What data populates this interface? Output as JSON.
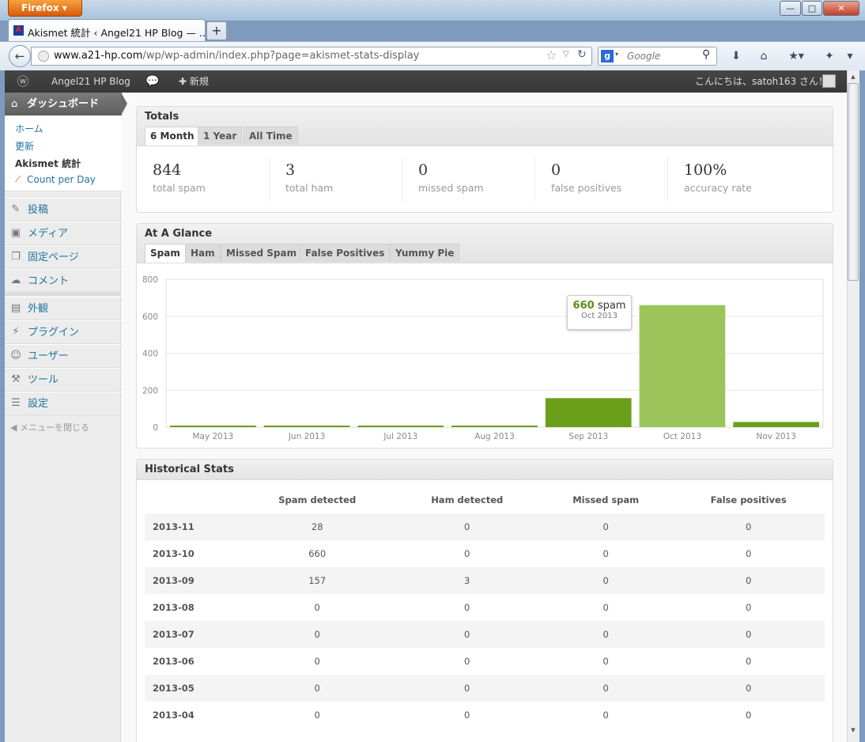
{
  "browser": {
    "menu_button": "Firefox",
    "tab_title": "Akismet 統計 ‹ Angel21 HP Blog — ...",
    "url_host": "www.a21-hp.com",
    "url_path": "/wp/wp-admin/index.php?page=akismet-stats-display",
    "search_placeholder": "Google",
    "new_tab": "+"
  },
  "adminbar": {
    "site_name": "Angel21 HP Blog",
    "new_label": "新規",
    "greeting": "こんにちは、satoh163 さん！"
  },
  "sidebar": {
    "dashboard": "ダッシュボード",
    "submenu": [
      "ホーム",
      "更新",
      "Akismet 統計",
      "Count per Day"
    ],
    "menu": [
      {
        "label": "投稿",
        "icon": "pin-icon"
      },
      {
        "label": "メディア",
        "icon": "media-icon"
      },
      {
        "label": "固定ページ",
        "icon": "pages-icon"
      },
      {
        "label": "コメント",
        "icon": "comment-icon"
      },
      {
        "label": "外観",
        "icon": "appearance-icon"
      },
      {
        "label": "プラグイン",
        "icon": "plugin-icon"
      },
      {
        "label": "ユーザー",
        "icon": "users-icon"
      },
      {
        "label": "ツール",
        "icon": "tools-icon"
      },
      {
        "label": "設定",
        "icon": "settings-icon"
      }
    ],
    "collapse": "メニューを閉じる"
  },
  "totals": {
    "title": "Totals",
    "tabs": [
      "6 Month",
      "1 Year",
      "All Time"
    ],
    "stats": [
      {
        "value": "844",
        "label": "total spam"
      },
      {
        "value": "3",
        "label": "total ham"
      },
      {
        "value": "0",
        "label": "missed spam"
      },
      {
        "value": "0",
        "label": "false positives"
      },
      {
        "value": "100%",
        "label": "accuracy rate"
      }
    ]
  },
  "glance": {
    "title": "At A Glance",
    "tabs": [
      "Spam",
      "Ham",
      "Missed Spam",
      "False Positives",
      "Yummy Pie"
    ],
    "tooltip": {
      "value": "660",
      "unit": "spam",
      "date": "Oct 2013"
    }
  },
  "chart_data": {
    "type": "bar",
    "categories": [
      "May 2013",
      "Jun 2013",
      "Jul 2013",
      "Aug 2013",
      "Sep 2013",
      "Oct 2013",
      "Nov 2013"
    ],
    "values": [
      0,
      0,
      0,
      0,
      157,
      660,
      28
    ],
    "ylim": [
      0,
      800
    ],
    "yticks": [
      0,
      200,
      400,
      600,
      800
    ],
    "grid": true,
    "highlight_index": 5,
    "colors": {
      "bar": "#6b9e19",
      "highlight": "#9bc55a"
    }
  },
  "historical": {
    "title": "Historical Stats",
    "headers": [
      "",
      "Spam detected",
      "Ham detected",
      "Missed spam",
      "False positives"
    ],
    "rows": [
      [
        "2013-11",
        "28",
        "0",
        "0",
        "0"
      ],
      [
        "2013-10",
        "660",
        "0",
        "0",
        "0"
      ],
      [
        "2013-09",
        "157",
        "3",
        "0",
        "0"
      ],
      [
        "2013-08",
        "0",
        "0",
        "0",
        "0"
      ],
      [
        "2013-07",
        "0",
        "0",
        "0",
        "0"
      ],
      [
        "2013-06",
        "0",
        "0",
        "0",
        "0"
      ],
      [
        "2013-05",
        "0",
        "0",
        "0",
        "0"
      ],
      [
        "2013-04",
        "0",
        "0",
        "0",
        "0"
      ]
    ]
  }
}
